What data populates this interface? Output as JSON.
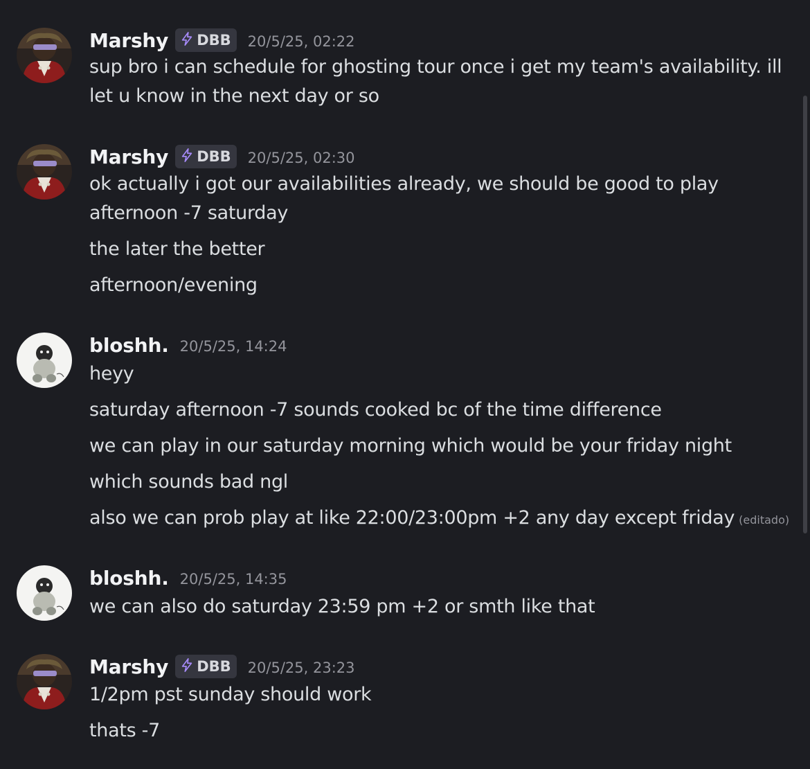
{
  "messages": [
    {
      "author": "Marshy",
      "tag": "DBB",
      "timestamp": "20/5/25, 02:22",
      "lines": [
        "sup bro i can schedule for ghosting tour once i get my team's availability. ill",
        "let u know in the next day or so"
      ]
    },
    {
      "author": "Marshy",
      "tag": "DBB",
      "timestamp": "20/5/25, 02:30",
      "lines": [
        "ok actually i got our availabilities already, we should be good to play",
        "afternoon -7 saturday",
        "the later the better",
        "afternoon/evening"
      ]
    },
    {
      "author": "bloshh.",
      "timestamp": "20/5/25, 14:24",
      "lines": [
        "heyy",
        "saturday afternoon -7 sounds cooked bc of the time difference",
        "we can play in our saturday morning which would be your friday night",
        "which sounds bad ngl",
        "also we can prob play at like 22:00/23:00pm +2 any day except friday"
      ],
      "edited_label": "(editado)"
    },
    {
      "author": "bloshh.",
      "timestamp": "20/5/25, 14:35",
      "lines": [
        "we can also do saturday 23:59 pm +2 or smth like that"
      ]
    },
    {
      "author": "Marshy",
      "tag": "DBB",
      "timestamp": "20/5/25, 23:23",
      "lines": [
        "1/2pm pst sunday should work",
        "thats -7"
      ]
    }
  ],
  "icons": {
    "tag_icon": "lightning-bolt-icon",
    "tag_icon_color": "#a78bfa"
  },
  "colors": {
    "background": "#1c1d22",
    "username": "#f2f3f5",
    "message_text": "#dbdee1",
    "timestamp": "#94959c"
  }
}
